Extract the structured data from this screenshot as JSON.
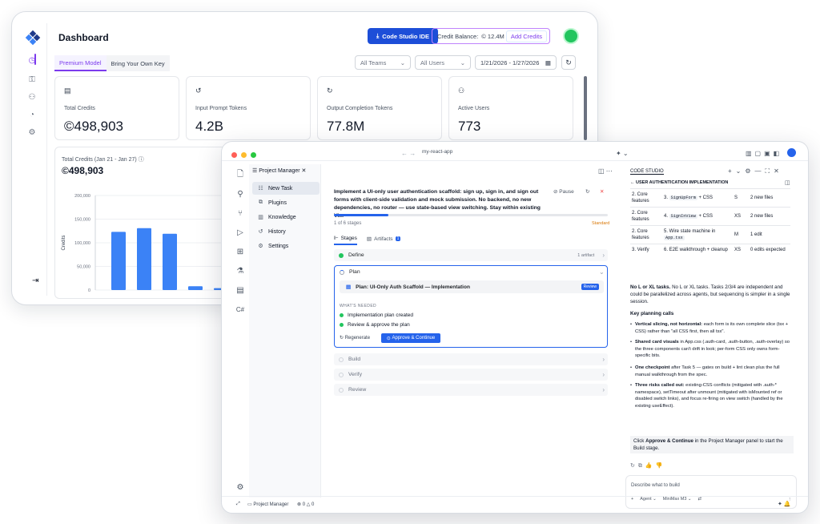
{
  "dashboard": {
    "title": "Dashboard",
    "ide_button": "Code Studio IDE",
    "credit_label": "Credit Balance:",
    "credit_value": "12.4M",
    "add_credits": "Add Credits",
    "tabs": [
      "Premium Model",
      "Bring Your Own Key"
    ],
    "filters": {
      "teams": "All Teams",
      "users": "All Users",
      "date_range": "1/21/2026 - 1/27/2026"
    },
    "stats": [
      {
        "label": "Total Credits",
        "value": "498,903"
      },
      {
        "label": "Input Prompt Tokens",
        "value": "4.2B"
      },
      {
        "label": "Output Completion Tokens",
        "value": "77.8M"
      },
      {
        "label": "Active Users",
        "value": "773"
      }
    ],
    "chart_title": "Total Credits (Jan 21 - Jan 27)",
    "chart_total": "498,903",
    "chart_data": {
      "type": "bar",
      "ylabel": "Credits",
      "ylim": [
        0,
        200000
      ],
      "yticks": [
        "200,000",
        "150,000",
        "100,000",
        "50,000",
        "0"
      ],
      "values": [
        123000,
        131000,
        119000,
        8000,
        4000
      ],
      "color": "#3b82f6"
    }
  },
  "ide": {
    "address": "my-react-app",
    "panel_tab": "Project Manager",
    "nav": [
      {
        "label": "New Task",
        "icon": "new-task-icon"
      },
      {
        "label": "Plugins",
        "icon": "plugin-icon"
      },
      {
        "label": "Knowledge",
        "icon": "book-icon"
      },
      {
        "label": "History",
        "icon": "history-icon"
      },
      {
        "label": "Settings",
        "icon": "gear-icon"
      }
    ],
    "task": {
      "title": "Implement a UI-only user authentication scaffold: sign up, sign in, and sign out forms with client-side validation and mock submission. No backend, no new dependencies, no router — use state-based view switching. Stay within existing Vi...",
      "pause": "Pause",
      "progress": 0.2,
      "stage_count": "1 of 6 stages",
      "badge": "Standard",
      "subtabs": {
        "stages": "Stages",
        "artifacts": "Artifacts",
        "artifacts_count": "1"
      },
      "define": {
        "label": "Define",
        "meta": "1 artifact"
      },
      "plan": {
        "label": "Plan",
        "doc": "Plan: UI-Only Auth Scaffold — Implementation",
        "review": "Review",
        "needed_label": "WHAT'S NEEDED",
        "needed": [
          "Implementation plan created",
          "Review & approve the plan"
        ],
        "regenerate": "Regenerate",
        "approve": "Approve & Continue"
      },
      "later_stages": [
        "Build",
        "Verify",
        "Review"
      ]
    },
    "chat": {
      "header": "CODE STUDIO",
      "subheader": "USER AUTHENTICATION IMPLEMENTATION",
      "table": [
        {
          "phase": "2. Core features",
          "task_code": "SignUpForm",
          "task_suffix": " + CSS",
          "task_prefix": "3. ",
          "size": "S",
          "files": "2 new files"
        },
        {
          "phase": "2. Core features",
          "task_code": "SignInView",
          "task_suffix": " + CSS",
          "task_prefix": "4. ",
          "size": "XS",
          "files": "2 new files"
        },
        {
          "phase": "2. Core features",
          "task_code": "App.tsx",
          "task_suffix": "",
          "task_prefix": "5. Wire state machine in ",
          "size": "M",
          "files": "1 edit"
        },
        {
          "phase": "3. Verify",
          "task_code": "",
          "task_suffix": "",
          "task_prefix": "6. E2E walkthrough + cleanup",
          "size": "XS",
          "files": "0 edits expected"
        }
      ],
      "para1": "No L or XL tasks. Tasks 2/3/4 are independent and could be parallelized across agents, but sequencing is simpler in a single session.",
      "key_title": "Key planning calls",
      "bullets": [
        {
          "bold": "Vertical slicing, not horizontal:",
          "text": " each form is its own complete slice (tsx + CSS) rather than \"all CSS first, then all tsx\"."
        },
        {
          "bold": "Shared card visuals",
          "text": " in App.css (.auth-card, .auth-button, .auth-overlay) so the three components can't drift in look; per-form CSS only owns form-specific bits."
        },
        {
          "bold": "One checkpoint",
          "text": " after Task 5 — gates on build + lint clean plus the full manual walkthrough from the spec."
        },
        {
          "bold": "Three risks called out:",
          "text": " existing-CSS conflicts (mitigated with .auth-* namespace), setTimeout after unmount (mitigated with isMounted ref or disabled switch links), and focus re-firing on view switch (handled by the existing useEffect)."
        }
      ],
      "callout_pre": "Click ",
      "callout_bold": "Approve & Continue",
      "callout_post": " in the Project Manager panel to start the Build stage.",
      "input_placeholder": "Describe what to build",
      "agent": "Agent",
      "model": "MiniMax M3",
      "default_approvals": "Default Approvals"
    },
    "status": {
      "panel": "Project Manager",
      "errors": "0",
      "warnings": "0"
    }
  }
}
